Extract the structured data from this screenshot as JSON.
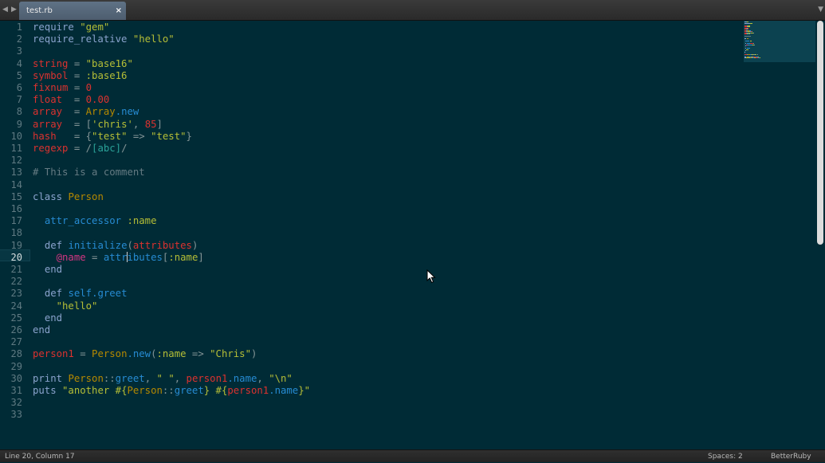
{
  "colors": {
    "background": "#002b36",
    "current_line": "#073642",
    "default": "#839496",
    "keyword": "#8aa3cd",
    "string": "#b5be36",
    "symbol": "#b5be36",
    "variable": "#dc322f",
    "number": "#dc322f",
    "constant": "#b58900",
    "method": "#268bd2",
    "regexp": "#2aa198",
    "comment": "#657b83",
    "ivar": "#d33682"
  },
  "tabbar": {
    "back_arrow": "◀",
    "forward_arrow": "▶",
    "tab_title": "test.rb",
    "tab_close": "×",
    "menu_arrow": "▼"
  },
  "editor": {
    "active_line": 20,
    "cursor_column": 17,
    "lines": [
      [
        [
          "require",
          "keyword"
        ],
        [
          " ",
          ""
        ],
        [
          "\"gem\"",
          "string"
        ]
      ],
      [
        [
          "require_relative",
          "keyword"
        ],
        [
          " ",
          ""
        ],
        [
          "\"hello\"",
          "string"
        ]
      ],
      [],
      [
        [
          "string",
          "variable"
        ],
        [
          " = ",
          ""
        ],
        [
          "\"base16\"",
          "string"
        ]
      ],
      [
        [
          "symbol",
          "variable"
        ],
        [
          " = ",
          ""
        ],
        [
          ":base16",
          "symbol"
        ]
      ],
      [
        [
          "fixnum",
          "variable"
        ],
        [
          " = ",
          ""
        ],
        [
          "0",
          "number"
        ]
      ],
      [
        [
          "float",
          "variable"
        ],
        [
          "  = ",
          ""
        ],
        [
          "0.00",
          "number"
        ]
      ],
      [
        [
          "array",
          "variable"
        ],
        [
          "  = ",
          ""
        ],
        [
          "Array",
          "constant"
        ],
        [
          ".new",
          "method"
        ]
      ],
      [
        [
          "array",
          "variable"
        ],
        [
          "  = [",
          ""
        ],
        [
          "'chris'",
          "string"
        ],
        [
          ", ",
          ""
        ],
        [
          "85",
          "number"
        ],
        [
          "]",
          ""
        ]
      ],
      [
        [
          "hash",
          "variable"
        ],
        [
          "   = {",
          ""
        ],
        [
          "\"test\"",
          "string"
        ],
        [
          " => ",
          ""
        ],
        [
          "\"test\"",
          "string"
        ],
        [
          "}",
          ""
        ]
      ],
      [
        [
          "regexp",
          "variable"
        ],
        [
          " = /",
          ""
        ],
        [
          "[abc]",
          "regexp"
        ],
        [
          "/",
          ""
        ]
      ],
      [],
      [
        [
          "# This is a comment",
          "comment"
        ]
      ],
      [],
      [
        [
          "class",
          "keyword"
        ],
        [
          " ",
          ""
        ],
        [
          "Person",
          "constant"
        ]
      ],
      [],
      [
        [
          "  ",
          ""
        ],
        [
          "attr_accessor",
          "method"
        ],
        [
          " ",
          ""
        ],
        [
          ":name",
          "symbol"
        ]
      ],
      [],
      [
        [
          "  ",
          ""
        ],
        [
          "def",
          "keyword"
        ],
        [
          " ",
          ""
        ],
        [
          "initialize",
          "method"
        ],
        [
          "(",
          ""
        ],
        [
          "attributes",
          "variable"
        ],
        [
          ")",
          ""
        ]
      ],
      [
        [
          "    ",
          ""
        ],
        [
          "@name",
          "ivar"
        ],
        [
          " = ",
          ""
        ],
        [
          "attr",
          "method"
        ],
        [
          "|caret|",
          ""
        ],
        [
          "ibutes",
          "method"
        ],
        [
          "[",
          ""
        ],
        [
          ":name",
          "symbol"
        ],
        [
          "]",
          ""
        ]
      ],
      [
        [
          "  ",
          ""
        ],
        [
          "end",
          "keyword"
        ]
      ],
      [],
      [
        [
          "  ",
          ""
        ],
        [
          "def",
          "keyword"
        ],
        [
          " ",
          ""
        ],
        [
          "self",
          "method"
        ],
        [
          ".greet",
          "method"
        ]
      ],
      [
        [
          "    ",
          ""
        ],
        [
          "\"hello\"",
          "string"
        ]
      ],
      [
        [
          "  ",
          ""
        ],
        [
          "end",
          "keyword"
        ]
      ],
      [
        [
          "end",
          "keyword"
        ]
      ],
      [],
      [
        [
          "person1",
          "variable"
        ],
        [
          " = ",
          ""
        ],
        [
          "Person",
          "constant"
        ],
        [
          ".new",
          "method"
        ],
        [
          "(",
          ""
        ],
        [
          ":name",
          "symbol"
        ],
        [
          " => ",
          ""
        ],
        [
          "\"Chris\"",
          "string"
        ],
        [
          ")",
          ""
        ]
      ],
      [],
      [
        [
          "print",
          "keyword"
        ],
        [
          " ",
          ""
        ],
        [
          "Person",
          "constant"
        ],
        [
          "::",
          ""
        ],
        [
          "greet",
          "method"
        ],
        [
          ", ",
          ""
        ],
        [
          "\" \"",
          "string"
        ],
        [
          ", ",
          ""
        ],
        [
          "person1",
          "variable"
        ],
        [
          ".name",
          "method"
        ],
        [
          ", ",
          ""
        ],
        [
          "\"\\n\"",
          "string"
        ]
      ],
      [
        [
          "puts",
          "keyword"
        ],
        [
          " ",
          ""
        ],
        [
          "\"another #{",
          "string"
        ],
        [
          "Person",
          "constant"
        ],
        [
          "::",
          ""
        ],
        [
          "greet",
          "method"
        ],
        [
          "}",
          "string"
        ],
        [
          " #{",
          "string"
        ],
        [
          "person1",
          "variable"
        ],
        [
          ".name",
          "method"
        ],
        [
          "}\"",
          "string"
        ]
      ],
      [],
      []
    ]
  },
  "statusbar": {
    "position": "Line 20, Column 17",
    "spaces": "Spaces: 2",
    "syntax": "BetterRuby"
  }
}
